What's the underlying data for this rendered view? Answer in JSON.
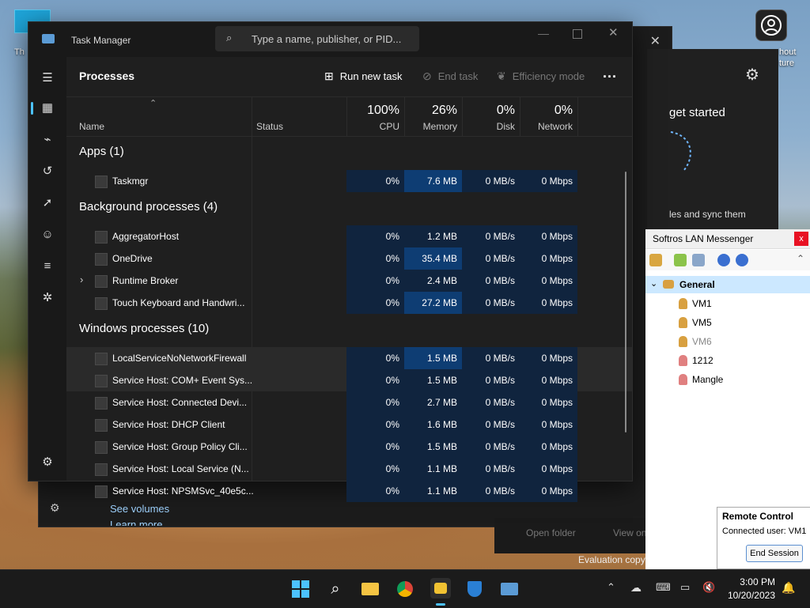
{
  "desktop": {
    "icon_label": "Th",
    "right_label_1": "hout",
    "right_label_2": "ture"
  },
  "onedrive": {
    "heading": "get started",
    "subtext": "les and sync them",
    "see_volumes": "See volumes",
    "learn_more": "Learn more",
    "open_folder": "Open folder",
    "view_online": "View on"
  },
  "evaluation": "Evaluation copy",
  "task_manager": {
    "title": "Task Manager",
    "search_placeholder": "Type a name, publisher, or PID...",
    "page_title": "Processes",
    "toolbar": {
      "run_new_task": "Run new task",
      "end_task": "End task",
      "efficiency_mode": "Efficiency mode",
      "more": "..."
    },
    "columns": {
      "name": "Name",
      "status": "Status",
      "cpu_pct": "100%",
      "cpu": "CPU",
      "memory_pct": "26%",
      "memory": "Memory",
      "disk_pct": "0%",
      "disk": "Disk",
      "network_pct": "0%",
      "network": "Network"
    },
    "groups": {
      "apps": "Apps (1)",
      "background": "Background processes (4)",
      "windows": "Windows processes (10)"
    },
    "apps": [
      {
        "name": "Taskmgr",
        "cpu": "0%",
        "memory": "7.6 MB",
        "disk": "0 MB/s",
        "network": "0 Mbps"
      }
    ],
    "background": [
      {
        "name": "AggregatorHost",
        "cpu": "0%",
        "memory": "1.2 MB",
        "disk": "0 MB/s",
        "network": "0 Mbps"
      },
      {
        "name": "OneDrive",
        "cpu": "0%",
        "memory": "35.4 MB",
        "disk": "0 MB/s",
        "network": "0 Mbps"
      },
      {
        "name": "Runtime Broker",
        "cpu": "0%",
        "memory": "2.4 MB",
        "disk": "0 MB/s",
        "network": "0 Mbps"
      },
      {
        "name": "Touch Keyboard and Handwri...",
        "cpu": "0%",
        "memory": "27.2 MB",
        "disk": "0 MB/s",
        "network": "0 Mbps"
      }
    ],
    "windows": [
      {
        "name": "LocalServiceNoNetworkFirewall",
        "cpu": "0%",
        "memory": "1.5 MB",
        "disk": "0 MB/s",
        "network": "0 Mbps"
      },
      {
        "name": "Service Host: COM+ Event Sys...",
        "cpu": "0%",
        "memory": "1.5 MB",
        "disk": "0 MB/s",
        "network": "0 Mbps"
      },
      {
        "name": "Service Host: Connected Devi...",
        "cpu": "0%",
        "memory": "2.7 MB",
        "disk": "0 MB/s",
        "network": "0 Mbps"
      },
      {
        "name": "Service Host: DHCP Client",
        "cpu": "0%",
        "memory": "1.6 MB",
        "disk": "0 MB/s",
        "network": "0 Mbps"
      },
      {
        "name": "Service Host: Group Policy Cli...",
        "cpu": "0%",
        "memory": "1.5 MB",
        "disk": "0 MB/s",
        "network": "0 Mbps"
      },
      {
        "name": "Service Host: Local Service (N...",
        "cpu": "0%",
        "memory": "1.1 MB",
        "disk": "0 MB/s",
        "network": "0 Mbps"
      },
      {
        "name": "Service Host: NPSMSvc_40e5c...",
        "cpu": "0%",
        "memory": "1.1 MB",
        "disk": "0 MB/s",
        "network": "0 Mbps"
      }
    ]
  },
  "messenger": {
    "title": "Softros LAN Messenger",
    "close": "x",
    "group": "General",
    "users": [
      {
        "name": "VM1",
        "color": "#d8a040"
      },
      {
        "name": "VM5",
        "color": "#d8a040"
      },
      {
        "name": "VM6",
        "color": "#d8a040"
      },
      {
        "name": "1212",
        "color": "#e08080"
      },
      {
        "name": "Mangle",
        "color": "#e08080"
      }
    ]
  },
  "remote_control": {
    "title": "Remote Control",
    "connected": "Connected user: VM1",
    "end_session": "End Session"
  },
  "taskbar": {
    "time": "3:00 PM",
    "date": "10/20/2023"
  },
  "colors": {
    "accent": "#4cc2ff",
    "memory_hot": "#0e3d73",
    "cell": "#10243e",
    "row_hover": "#2a2a2a"
  }
}
